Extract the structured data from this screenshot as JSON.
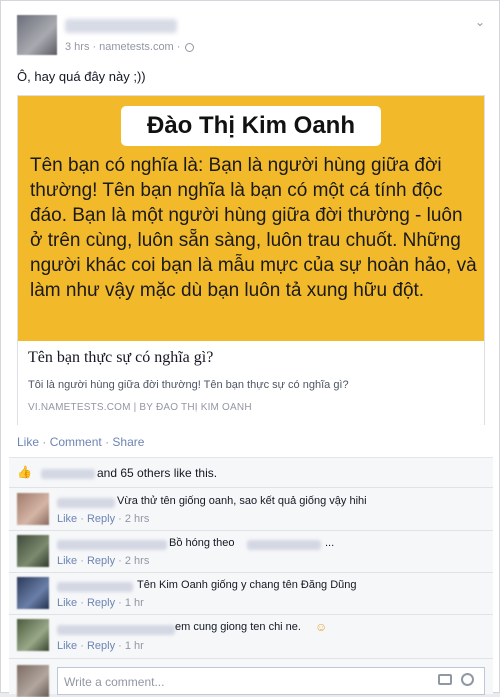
{
  "post": {
    "time": "3 hrs",
    "source": "nametests.com",
    "separator": "·",
    "status": "Ô, hay quá đây này ;))"
  },
  "share": {
    "name": "Đào Thị Kim Oanh",
    "image_text": "Tên bạn có nghĩa là: Bạn là người hùng giữa đời thường! Tên bạn nghĩa là bạn có một cá tính độc đáo. Bạn là một người hùng giữa đời thường - luôn ở trên cùng, luôn sẵn sàng, luôn trau chuốt. Những người khác coi bạn là mẫu mực của sự hoàn hảo, và làm như vậy mặc dù bạn luôn tả xung hữu đột.",
    "title": "Tên bạn thực sự có nghĩa gì?",
    "description": "Tôi là người hùng giữa đời thường! Tên bạn thực sự có nghĩa gì?",
    "source": "VI.NAMETESTS.COM   |   BY ĐAO THỊ KIM OANH"
  },
  "actions": {
    "like": "Like",
    "comment": "Comment",
    "share": "Share",
    "dot": "·"
  },
  "likes": {
    "text": "and 65 others like this."
  },
  "comments": [
    {
      "text": "Vừa thử tên giống oanh, sao kết quả giống vậy hihi",
      "like": "Like",
      "reply": "Reply",
      "time": "2 hrs"
    },
    {
      "text": "Bồ hóng theo",
      "suffix": "...",
      "like": "Like",
      "reply": "Reply",
      "time": "2 hrs"
    },
    {
      "text": "Tên Kim Oanh giống y chang tên Đăng Dũng",
      "like": "Like",
      "reply": "Reply",
      "time": "1 hr"
    },
    {
      "text": "em cung giong ten chi ne.",
      "like": "Like",
      "reply": "Reply",
      "time": "1 hr"
    }
  ],
  "composer": {
    "placeholder": "Write a comment..."
  },
  "colors": {
    "link": "#6d84b4",
    "banner": "#f2b92a",
    "muted": "#9197a3"
  }
}
